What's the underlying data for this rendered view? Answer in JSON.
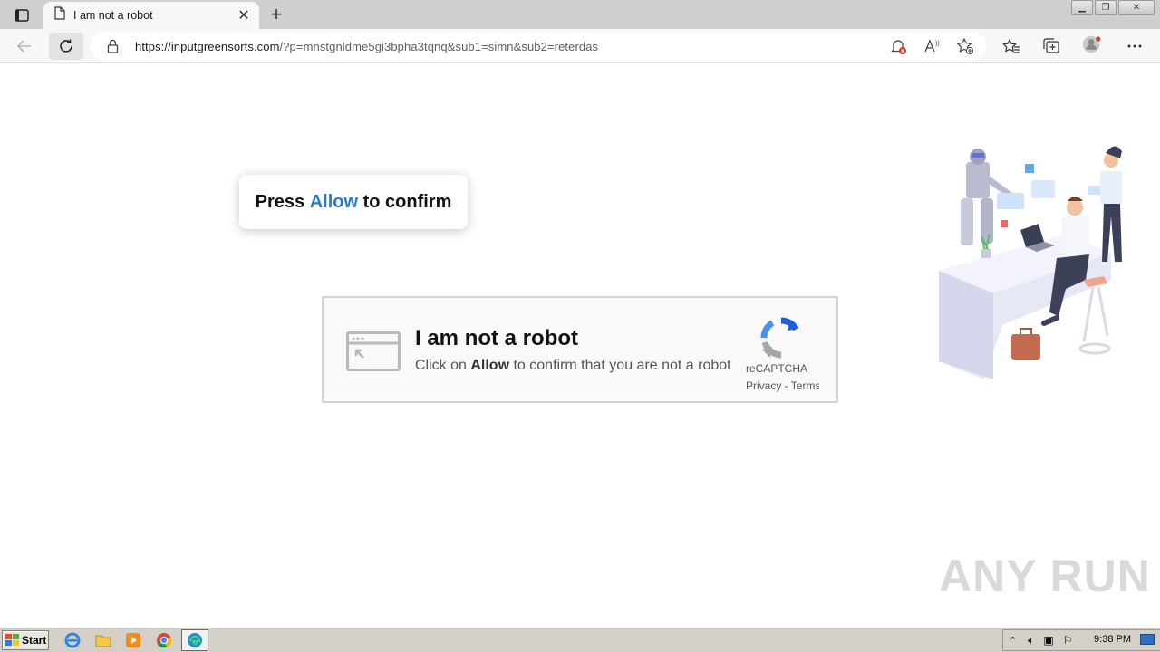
{
  "browser": {
    "tab_title": "I am not a robot",
    "url_host": "https://inputgreensorts.com",
    "url_rest": "/?p=mnstgnldme5gi3bpha3tqnq&sub1=simn&sub2=reterdas"
  },
  "page": {
    "press_prefix": "Press ",
    "press_allow": "Allow",
    "press_suffix": " to confirm",
    "captcha_title": "I am not a robot",
    "captcha_sub_prefix": "Click on ",
    "captcha_sub_allow": "Allow",
    "captcha_sub_suffix": " to confirm that you are not a robot",
    "recaptcha_name": "reCAPTCHA",
    "recaptcha_links": "Privacy - Terms",
    "watermark": "ANY RUN"
  },
  "taskbar": {
    "start_label": "Start",
    "clock": "9:38 PM"
  },
  "colors": {
    "allow_blue": "#2a7ac4",
    "recaptcha_blue": "#1c5ee0",
    "recaptcha_gray": "#a6a6a6"
  },
  "icons": [
    "tab-actions-icon",
    "page-icon",
    "close-icon",
    "plus-icon",
    "back-icon",
    "reload-icon",
    "lock-icon",
    "notification-blocked-icon",
    "read-aloud-icon",
    "add-favorite-icon",
    "favorites-icon",
    "collections-icon",
    "profile-icon",
    "more-icon",
    "browser-window-icon",
    "recaptcha-logo-icon",
    "ie-icon",
    "explorer-icon",
    "media-player-icon",
    "chrome-icon",
    "edge-icon"
  ]
}
